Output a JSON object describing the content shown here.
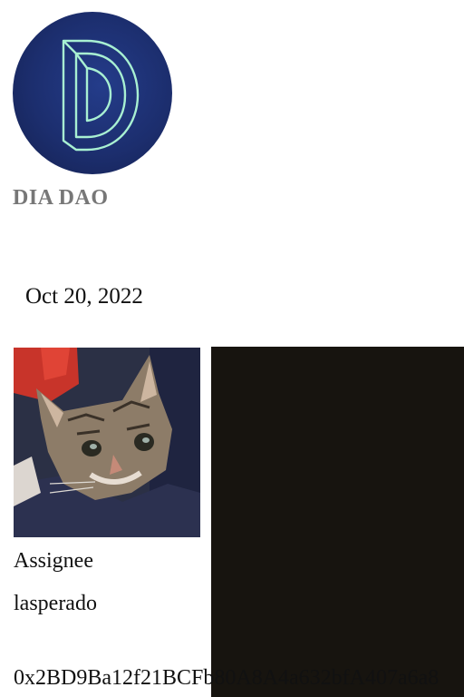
{
  "org": {
    "name": "DIA DAO",
    "logo_icon": "dia-dao-logo-icon",
    "logo_colors": {
      "background": "#1c2e6e",
      "outline": "#a8f0d2"
    }
  },
  "post": {
    "date": "Oct 20, 2022"
  },
  "assignee": {
    "avatar_icon": "cat-avatar-image",
    "role_label": "Assignee",
    "username": "lasperado",
    "address": "0x2BD9Ba12f21BCFb80A8A4a632bfA407a6a8"
  },
  "media": {
    "panel_color": "#17140f"
  }
}
